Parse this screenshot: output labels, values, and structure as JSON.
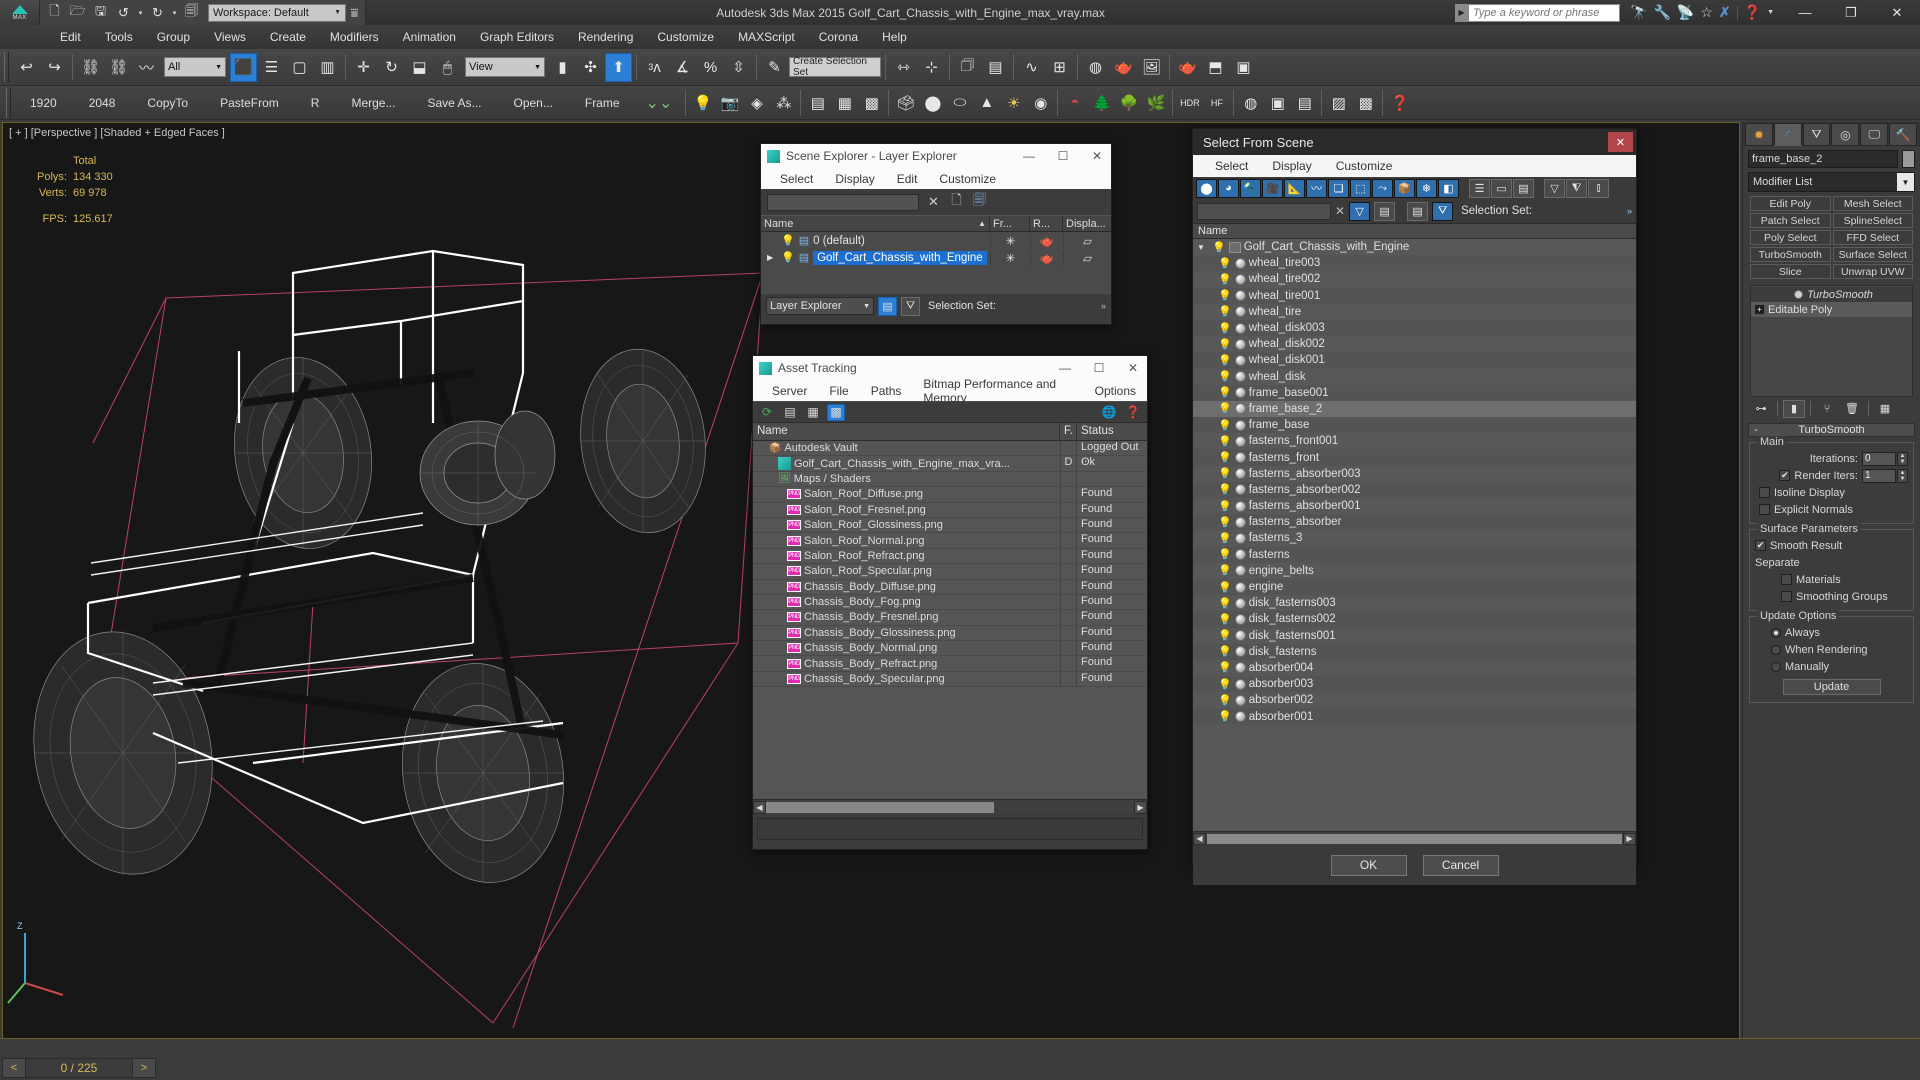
{
  "titlebar": {
    "logo_label": "MAX",
    "workspace": "Workspace: Default",
    "app_title": "Autodesk 3ds Max  2015    Golf_Cart_Chassis_with_Engine_max_vray.max",
    "search_placeholder": "Type a keyword or phrase",
    "quick_access": [
      "new-icon",
      "open-icon",
      "save-icon",
      "undo-icon",
      "redo-icon",
      "set-project-icon"
    ],
    "info_icons": [
      "binoculars-icon",
      "wrench-icon",
      "satellite-icon",
      "star-icon",
      "exchange-icon",
      "help-icon"
    ],
    "window_buttons": [
      "minimize",
      "maximize",
      "close"
    ]
  },
  "menubar": {
    "items": [
      "Edit",
      "Tools",
      "Group",
      "Views",
      "Create",
      "Modifiers",
      "Animation",
      "Graph Editors",
      "Rendering",
      "Customize",
      "MAXScript",
      "Corona",
      "Help"
    ]
  },
  "toolbar1": {
    "selection_filter": "All",
    "reference_coord": "View",
    "named_selection_set": "Create Selection Set",
    "snap_value": "3"
  },
  "toolbar2": {
    "items": [
      "1920",
      "2048",
      "CopyTo",
      "PasteFrom",
      "R",
      "Merge...",
      "Save As...",
      "Open...",
      "Frame"
    ]
  },
  "viewport": {
    "label": "[ + ] [Perspective ] [Shaded + Edged Faces ]",
    "stats": {
      "total_header": "Total",
      "polys_label": "Polys:",
      "polys_value": "134 330",
      "verts_label": "Verts:",
      "verts_value": "69 978",
      "fps_label": "FPS:",
      "fps_value": "125.617"
    },
    "axis_label": "Z"
  },
  "scene_explorer": {
    "title": "Scene Explorer - Layer Explorer",
    "menu": [
      "Select",
      "Display",
      "Edit",
      "Customize"
    ],
    "search_value": "",
    "columns": [
      "Name",
      "Fr...",
      "R...",
      "Displa..."
    ],
    "rows": [
      {
        "name": "0 (default)",
        "selected": false,
        "expandable": false
      },
      {
        "name": "Golf_Cart_Chassis_with_Engine",
        "selected": true,
        "expandable": true
      }
    ],
    "footer_mode": "Layer Explorer",
    "footer_selection_set_label": "Selection Set:"
  },
  "asset_tracking": {
    "title": "Asset Tracking",
    "menu": [
      "Server",
      "File",
      "Paths",
      "Bitmap Performance and Memory",
      "Options"
    ],
    "columns": [
      "Name",
      "F.",
      "Status"
    ],
    "rows": [
      {
        "name": "Autodesk Vault",
        "icon": "vault-icon",
        "flag": "",
        "status": "Logged Out ...",
        "depth": 1
      },
      {
        "name": "Golf_Cart_Chassis_with_Engine_max_vra...",
        "icon": "max-icon",
        "flag": "D",
        "status": "Ok",
        "depth": 2
      },
      {
        "name": "Maps / Shaders",
        "icon": "maps-icon",
        "flag": "",
        "status": "",
        "depth": 2
      },
      {
        "name": "Salon_Roof_Diffuse.png",
        "icon": "png-icon",
        "flag": "",
        "status": "Found",
        "depth": 3
      },
      {
        "name": "Salon_Roof_Fresnel.png",
        "icon": "png-icon",
        "flag": "",
        "status": "Found",
        "depth": 3
      },
      {
        "name": "Salon_Roof_Glossiness.png",
        "icon": "png-icon",
        "flag": "",
        "status": "Found",
        "depth": 3
      },
      {
        "name": "Salon_Roof_Normal.png",
        "icon": "png-icon",
        "flag": "",
        "status": "Found",
        "depth": 3
      },
      {
        "name": "Salon_Roof_Refract.png",
        "icon": "png-icon",
        "flag": "",
        "status": "Found",
        "depth": 3
      },
      {
        "name": "Salon_Roof_Specular.png",
        "icon": "png-icon",
        "flag": "",
        "status": "Found",
        "depth": 3
      },
      {
        "name": "Chassis_Body_Diffuse.png",
        "icon": "png-icon",
        "flag": "",
        "status": "Found",
        "depth": 3
      },
      {
        "name": "Chassis_Body_Fog.png",
        "icon": "png-icon",
        "flag": "",
        "status": "Found",
        "depth": 3
      },
      {
        "name": "Chassis_Body_Fresnel.png",
        "icon": "png-icon",
        "flag": "",
        "status": "Found",
        "depth": 3
      },
      {
        "name": "Chassis_Body_Glossiness.png",
        "icon": "png-icon",
        "flag": "",
        "status": "Found",
        "depth": 3
      },
      {
        "name": "Chassis_Body_Normal.png",
        "icon": "png-icon",
        "flag": "",
        "status": "Found",
        "depth": 3
      },
      {
        "name": "Chassis_Body_Refract.png",
        "icon": "png-icon",
        "flag": "",
        "status": "Found",
        "depth": 3
      },
      {
        "name": "Chassis_Body_Specular.png",
        "icon": "png-icon",
        "flag": "",
        "status": "Found",
        "depth": 3
      }
    ]
  },
  "select_from_scene": {
    "title": "Select From Scene",
    "menu": [
      "Select",
      "Display",
      "Customize"
    ],
    "search_value": "",
    "selection_set_label": "Selection Set:",
    "column_name": "Name",
    "root": {
      "name": "Golf_Cart_Chassis_with_Engine",
      "expanded": true
    },
    "rows": [
      {
        "name": "wheal_tire003",
        "selected": false
      },
      {
        "name": "wheal_tire002",
        "selected": false
      },
      {
        "name": "wheal_tire001",
        "selected": false
      },
      {
        "name": "wheal_tire",
        "selected": false
      },
      {
        "name": "wheal_disk003",
        "selected": false
      },
      {
        "name": "wheal_disk002",
        "selected": false
      },
      {
        "name": "wheal_disk001",
        "selected": false
      },
      {
        "name": "wheal_disk",
        "selected": false
      },
      {
        "name": "frame_base001",
        "selected": false
      },
      {
        "name": "frame_base_2",
        "selected": true
      },
      {
        "name": "frame_base",
        "selected": false
      },
      {
        "name": "fasterns_front001",
        "selected": false
      },
      {
        "name": "fasterns_front",
        "selected": false
      },
      {
        "name": "fasterns_absorber003",
        "selected": false
      },
      {
        "name": "fasterns_absorber002",
        "selected": false
      },
      {
        "name": "fasterns_absorber001",
        "selected": false
      },
      {
        "name": "fasterns_absorber",
        "selected": false
      },
      {
        "name": "fasterns_3",
        "selected": false
      },
      {
        "name": "fasterns",
        "selected": false
      },
      {
        "name": "engine_belts",
        "selected": false
      },
      {
        "name": "engine",
        "selected": false
      },
      {
        "name": "disk_fasterns003",
        "selected": false
      },
      {
        "name": "disk_fasterns002",
        "selected": false
      },
      {
        "name": "disk_fasterns001",
        "selected": false
      },
      {
        "name": "disk_fasterns",
        "selected": false
      },
      {
        "name": "absorber004",
        "selected": false
      },
      {
        "name": "absorber003",
        "selected": false
      },
      {
        "name": "absorber002",
        "selected": false
      },
      {
        "name": "absorber001",
        "selected": false
      }
    ],
    "buttons": {
      "ok": "OK",
      "cancel": "Cancel"
    }
  },
  "command_panel": {
    "tabs": [
      "create-icon",
      "modify-icon",
      "hierarchy-icon",
      "motion-icon",
      "display-icon",
      "utilities-icon"
    ],
    "active_tab_index": 1,
    "object_name": "frame_base_2",
    "modifier_list_label": "Modifier List",
    "modifier_buttons": [
      "Edit Poly",
      "Mesh Select",
      "Patch Select",
      "SplineSelect",
      "Poly Select",
      "FFD Select",
      "TurboSmooth",
      "Surface Select",
      "Slice",
      "Unwrap UVW"
    ],
    "stack": [
      {
        "name": "TurboSmooth",
        "active": true
      },
      {
        "name": "Editable Poly",
        "active": false
      }
    ],
    "rollout": {
      "title": "TurboSmooth",
      "minus": "-",
      "groups": [
        {
          "label": "Main",
          "rows": [
            {
              "type": "spinner",
              "label": "Iterations:",
              "value": "0"
            },
            {
              "type": "check-spinner",
              "label": "Render Iters:",
              "value": "1",
              "checked": true
            },
            {
              "type": "checkbox",
              "label": "Isoline Display",
              "checked": false
            },
            {
              "type": "checkbox",
              "label": "Explicit Normals",
              "checked": false
            }
          ]
        },
        {
          "label": "Surface Parameters",
          "rows": [
            {
              "type": "checkbox",
              "label": "Smooth Result",
              "checked": true
            },
            {
              "type": "text",
              "label": "Separate"
            },
            {
              "type": "checkbox-indent",
              "label": "Materials",
              "checked": false
            },
            {
              "type": "checkbox-indent",
              "label": "Smoothing Groups",
              "checked": false
            }
          ]
        },
        {
          "label": "Update Options",
          "rows": [
            {
              "type": "radio",
              "label": "Always",
              "checked": true
            },
            {
              "type": "radio",
              "label": "When Rendering",
              "checked": false
            },
            {
              "type": "radio",
              "label": "Manually",
              "checked": false
            },
            {
              "type": "button",
              "label": "Update"
            }
          ]
        }
      ]
    }
  },
  "bottombar": {
    "prev": "<",
    "frame_counter": "0 / 225",
    "next": ">"
  }
}
